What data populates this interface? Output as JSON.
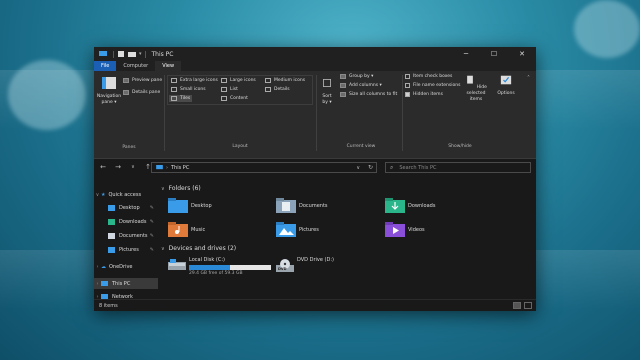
{
  "window": {
    "title": "This PC"
  },
  "ribbon_tabs": [
    "File",
    "Computer",
    "View"
  ],
  "ribbon": {
    "panes": {
      "label": "Panes",
      "navigation_pane": "Navigation pane ▾",
      "preview_pane": "Preview pane",
      "details_pane": "Details pane"
    },
    "layout": {
      "label": "Layout",
      "items": [
        "Extra large icons",
        "Large icons",
        "Medium icons",
        "Small icons",
        "List",
        "Details",
        "Tiles",
        "Content"
      ],
      "selected": "Tiles"
    },
    "current_view": {
      "label": "Current view",
      "sort_by": "Sort by ▾",
      "group_by": "Group by ▾",
      "add_columns": "Add columns ▾",
      "size_all_columns": "Size all columns to fit"
    },
    "show_hide": {
      "label": "Show/hide",
      "item_check_boxes": "Item check boxes",
      "file_name_extensions": "File name extensions",
      "hidden_items": "Hidden items",
      "hide_selected": "Hide selected items",
      "options": "Options"
    }
  },
  "address": {
    "path": "This PC",
    "search_placeholder": "Search This PC"
  },
  "sidebar": {
    "quick_access": "Quick access",
    "quick_items": [
      "Desktop",
      "Downloads",
      "Documents",
      "Pictures"
    ],
    "onedrive": "OneDrive",
    "this_pc": "This PC",
    "network": "Network"
  },
  "content": {
    "folders_header": "Folders (6)",
    "folders": [
      "Desktop",
      "Documents",
      "Downloads",
      "Music",
      "Pictures",
      "Videos"
    ],
    "devices_header": "Devices and drives (2)",
    "local_disk": {
      "name": "Local Disk (C:)",
      "free": "29.4 GB free of 59.3 GB",
      "used_fraction": 0.5
    },
    "dvd": {
      "name": "DVD Drive (D:)",
      "label": "DVD"
    }
  },
  "status": {
    "items": "8 items"
  },
  "colors": {
    "accent": "#1a5fb4",
    "folder": "#e7b841",
    "bar_fill": "#2a8ad8"
  }
}
